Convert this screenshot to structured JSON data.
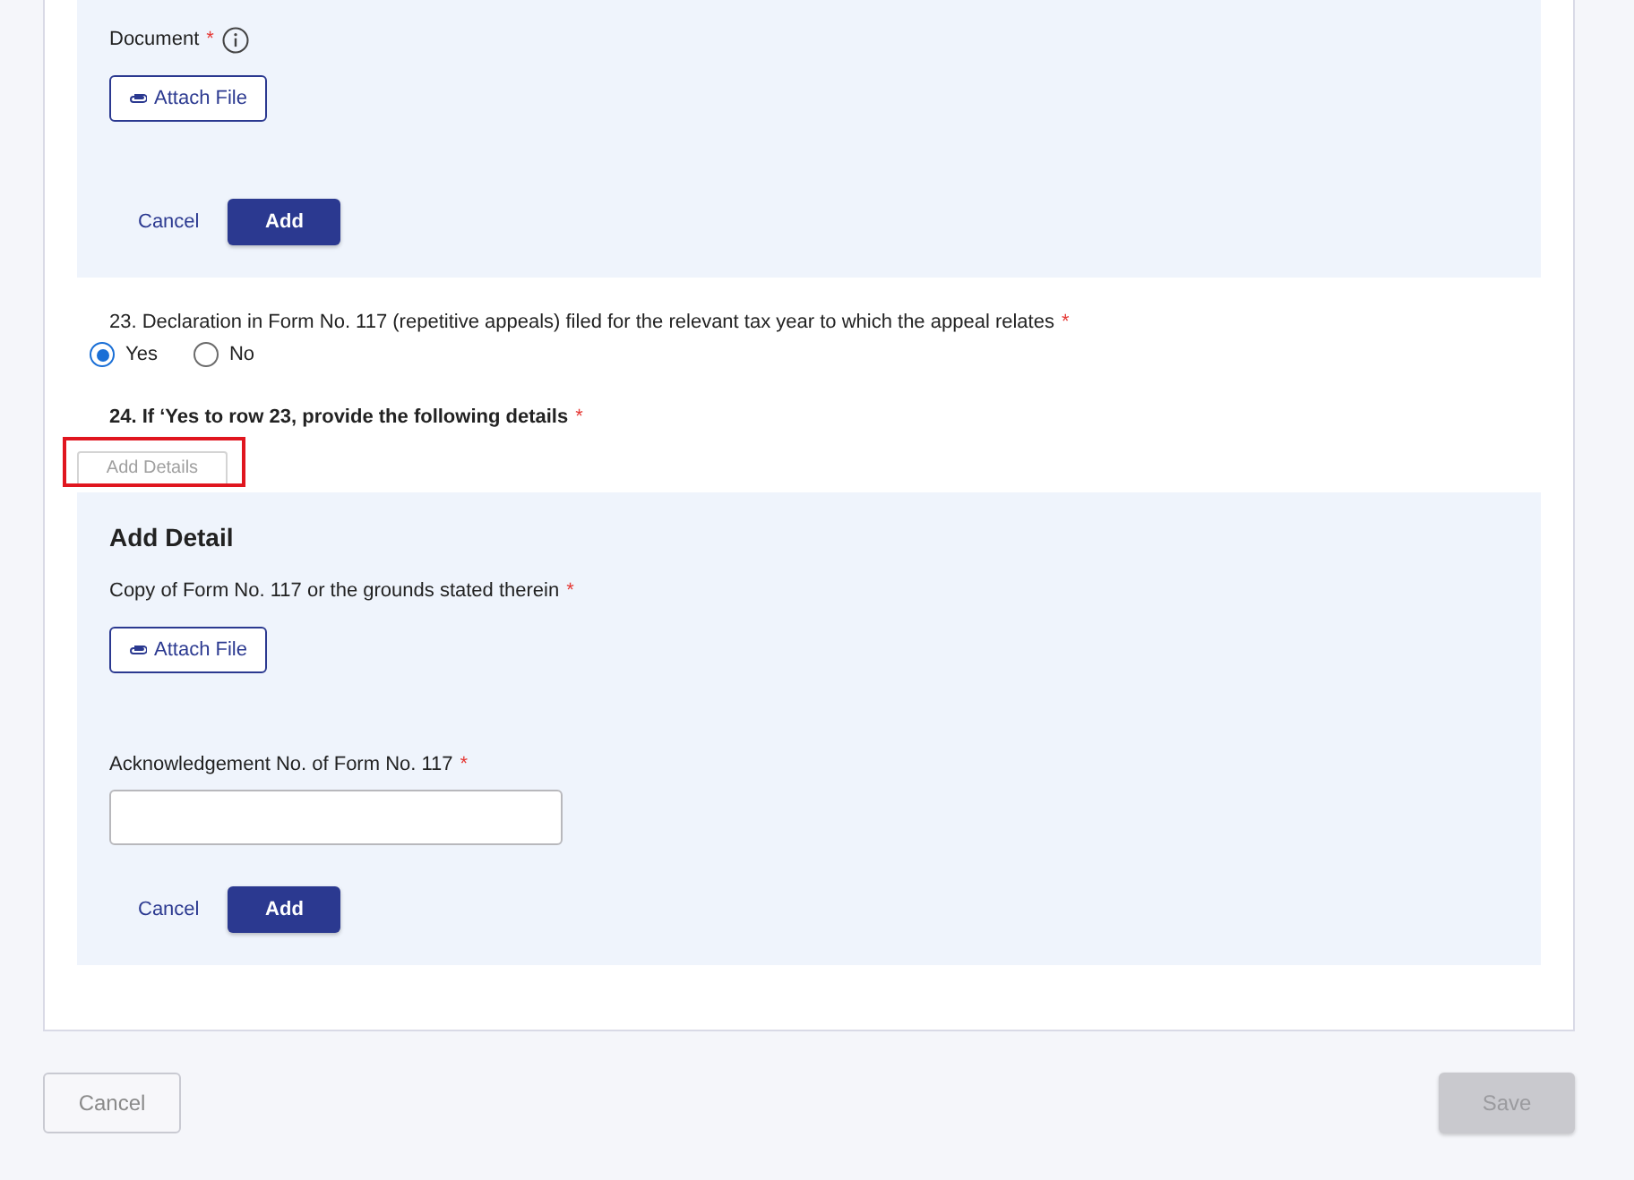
{
  "sections": [
    {
      "kind": "panel",
      "fields": [
        {
          "kind": "file",
          "label": "Document",
          "required_mark": "*",
          "info": true,
          "button": "Attach File"
        }
      ],
      "actions": [
        {
          "label": "Cancel",
          "kind": "link"
        },
        {
          "label": "Add",
          "kind": "primary"
        }
      ]
    },
    {
      "kind": "radio_question",
      "text": "23. Declaration in Form No. 117 (repetitive appeals) filed for the relevant tax year to which the appeal relates",
      "required_mark": "*",
      "options": [
        {
          "label": "Yes",
          "selected": true
        },
        {
          "label": "No",
          "selected": false
        }
      ]
    },
    {
      "kind": "button_question",
      "text": "24. If ‘Yes to row 23, provide the following details",
      "required_mark": "*",
      "button": {
        "label": "Add Details",
        "disabled": true,
        "highlighted": true
      }
    },
    {
      "kind": "panel",
      "title": "Add Detail",
      "fields": [
        {
          "kind": "file",
          "label": "Copy of Form No. 117 or the grounds stated therein",
          "required_mark": "*",
          "info": false,
          "button": "Attach File"
        },
        {
          "kind": "text",
          "label": "Acknowledgement No. of Form No. 117",
          "required_mark": "*",
          "info": false
        }
      ],
      "actions": [
        {
          "label": "Cancel",
          "kind": "link"
        },
        {
          "label": "Add",
          "kind": "primary"
        }
      ]
    }
  ],
  "footer": {
    "buttons": [
      {
        "label": "Cancel",
        "kind": "outline",
        "disabled": false
      },
      {
        "label": "Save",
        "kind": "solid",
        "disabled": true
      }
    ]
  }
}
